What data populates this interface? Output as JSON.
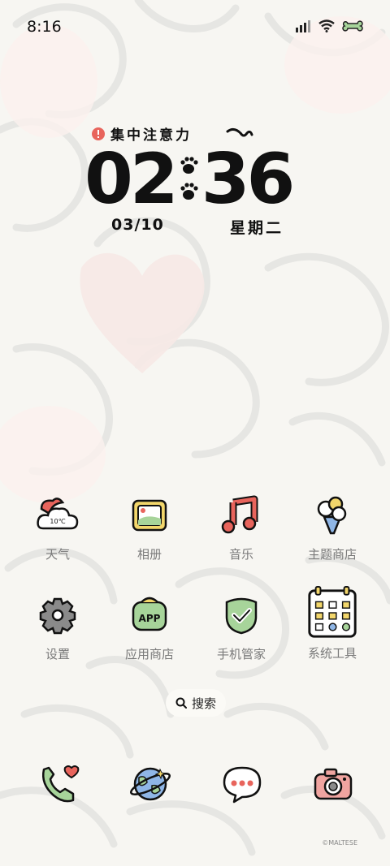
{
  "status_bar": {
    "time": "8:16",
    "icons": [
      "signal-icon",
      "wifi-icon",
      "battery-bone-icon"
    ]
  },
  "lock_widget": {
    "focus_label": "集中注意力",
    "hour": "02",
    "minute": "36",
    "date": "03/10",
    "weekday": "星期二"
  },
  "apps": [
    {
      "label": "天气",
      "icon": "weather-icon",
      "temp": "10℃"
    },
    {
      "label": "相册",
      "icon": "gallery-icon"
    },
    {
      "label": "音乐",
      "icon": "music-icon"
    },
    {
      "label": "主题商店",
      "icon": "theme-store-icon"
    },
    {
      "label": "设置",
      "icon": "settings-icon"
    },
    {
      "label": "应用商店",
      "icon": "app-store-icon",
      "badge": "APP"
    },
    {
      "label": "手机管家",
      "icon": "security-icon"
    },
    {
      "label": "系统工具",
      "icon": "system-tools-icon"
    }
  ],
  "search": {
    "label": "搜索"
  },
  "dock": [
    "phone-icon",
    "browser-icon",
    "messages-icon",
    "camera-icon"
  ],
  "watermark": "©MALTESE",
  "colors": {
    "accent_red": "#e8645c",
    "accent_green": "#a7d49a",
    "accent_yellow": "#f2d66b",
    "accent_blue": "#8fb6e6"
  }
}
